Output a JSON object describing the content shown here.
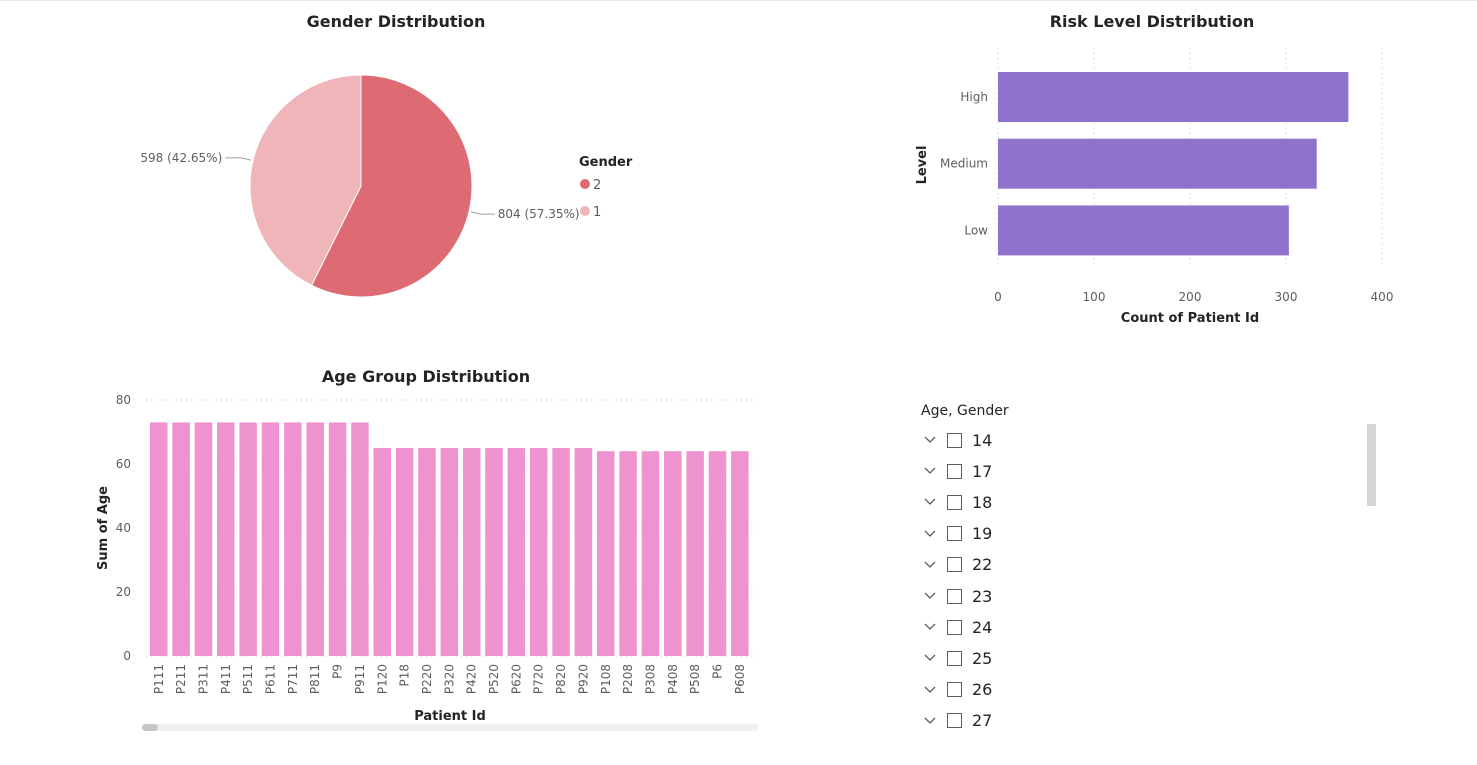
{
  "charts": {
    "gender": {
      "title": "Gender Distribution",
      "legend_title": "Gender"
    },
    "risk": {
      "title": "Risk Level Distribution"
    },
    "age": {
      "title": "Age Group Distribution"
    }
  },
  "chart_data": [
    {
      "type": "pie",
      "title": "Gender Distribution",
      "legend_title": "Gender",
      "legend_position": "right",
      "slices": [
        {
          "label": "2",
          "value": 804,
          "percent": "57.35%",
          "data_label": "804 (57.35%)",
          "color": "#de6a73"
        },
        {
          "label": "1",
          "value": 598,
          "percent": "42.65%",
          "data_label": "598 (42.65%)",
          "color": "#efb5b9"
        }
      ]
    },
    {
      "type": "bar",
      "orientation": "horizontal",
      "title": "Risk Level Distribution",
      "categories": [
        "High",
        "Medium",
        "Low"
      ],
      "values": [
        365,
        332,
        303
      ],
      "xlabel": "Count of Patient Id",
      "ylabel": "Level",
      "xlim": [
        0,
        400
      ],
      "xticks": [
        0,
        100,
        200,
        300,
        400
      ],
      "grid": true,
      "color": "#8f72cc"
    },
    {
      "type": "bar",
      "title": "Age Group Distribution",
      "categories": [
        "P111",
        "P211",
        "P311",
        "P411",
        "P511",
        "P611",
        "P711",
        "P811",
        "P9",
        "P911",
        "P120",
        "P18",
        "P220",
        "P320",
        "P420",
        "P520",
        "P620",
        "P720",
        "P820",
        "P920",
        "P108",
        "P208",
        "P308",
        "P408",
        "P508",
        "P6",
        "P608"
      ],
      "values": [
        73,
        73,
        73,
        73,
        73,
        73,
        73,
        73,
        73,
        73,
        65,
        65,
        65,
        65,
        65,
        65,
        65,
        65,
        65,
        65,
        64,
        64,
        64,
        64,
        64,
        64,
        64
      ],
      "xlabel": "Patient Id",
      "ylabel": "Sum of Age",
      "ylim": [
        0,
        80
      ],
      "yticks": [
        0,
        20,
        40,
        60,
        80
      ],
      "grid": true,
      "color": "#ee93cf"
    }
  ],
  "slicer": {
    "header": "Age, Gender",
    "items": [
      {
        "label": "14"
      },
      {
        "label": "17"
      },
      {
        "label": "18"
      },
      {
        "label": "19"
      },
      {
        "label": "22"
      },
      {
        "label": "23"
      },
      {
        "label": "24"
      },
      {
        "label": "25"
      },
      {
        "label": "26"
      },
      {
        "label": "27"
      }
    ]
  },
  "colors": {
    "pie_2": "#de6a73",
    "pie_1": "#efb5b9",
    "risk_bar": "#8f72cc",
    "age_bar": "#ee93cf",
    "grid": "#c8c6c4"
  }
}
